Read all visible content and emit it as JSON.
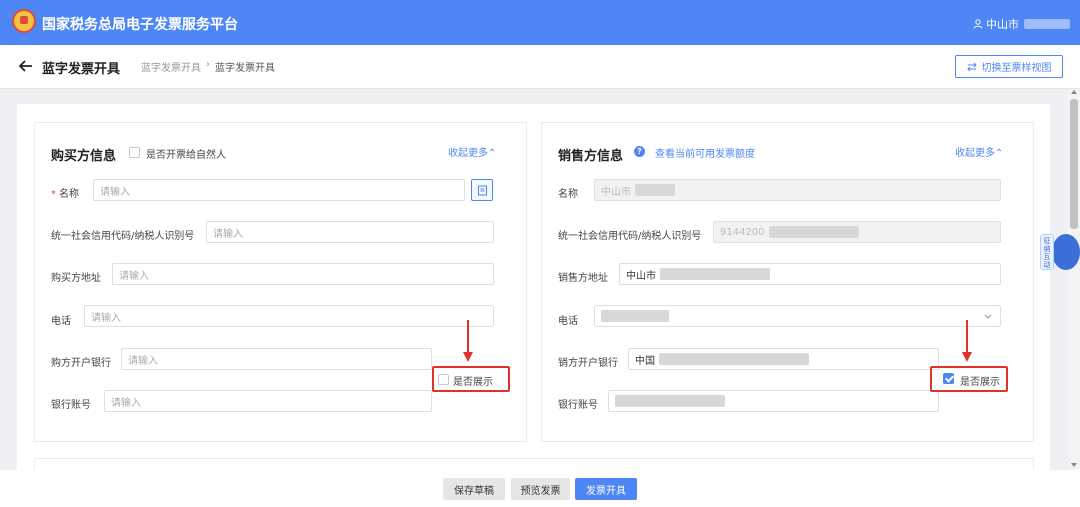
{
  "header": {
    "title": "国家税务总局电子发票服务平台",
    "user_prefix": "中山市"
  },
  "subheader": {
    "page_title": "蓝字发票开具",
    "breadcrumb": [
      "蓝字发票开具",
      "蓝字发票开具"
    ],
    "breadcrumb_sep": "›",
    "switch_button": "切换至票样视图"
  },
  "buyer": {
    "title": "购买方信息",
    "natural_person_checkbox": "是否开票给自然人",
    "collapse": "收起更多⌃",
    "fields": {
      "name": {
        "label": "名称",
        "placeholder": "请输入"
      },
      "tax_id": {
        "label": "统一社会信用代码/纳税人识别号",
        "placeholder": "请输入"
      },
      "address": {
        "label": "购买方地址",
        "placeholder": "请输入"
      },
      "phone": {
        "label": "电话",
        "placeholder": "请输入"
      },
      "bank": {
        "label": "购方开户银行",
        "placeholder": "请输入"
      },
      "account": {
        "label": "银行账号",
        "placeholder": "请输入"
      }
    },
    "show_checkbox": {
      "label": "是否展示",
      "checked": false
    }
  },
  "seller": {
    "title": "销售方信息",
    "quota_link": "查看当前可用发票额度",
    "collapse": "收起更多⌃",
    "fields": {
      "name": {
        "label": "名称",
        "value": "中山市"
      },
      "tax_id": {
        "label": "统一社会信用代码/纳税人识别号",
        "value": "9144200"
      },
      "address": {
        "label": "销售方地址",
        "value": "中山市"
      },
      "phone": {
        "label": "电话",
        "value": ""
      },
      "bank": {
        "label": "销方开户银行",
        "value": "中国"
      },
      "account": {
        "label": "银行账号",
        "value": ""
      }
    },
    "show_checkbox": {
      "label": "是否展示",
      "checked": true
    }
  },
  "footer": {
    "save_draft": "保存草稿",
    "preview": "预览发票",
    "issue": "发票开具"
  },
  "assistant": {
    "badge": "征纳互动"
  },
  "colors": {
    "primary": "#4e86f5",
    "highlight": "#e0322b",
    "required": "#e74c3c"
  }
}
